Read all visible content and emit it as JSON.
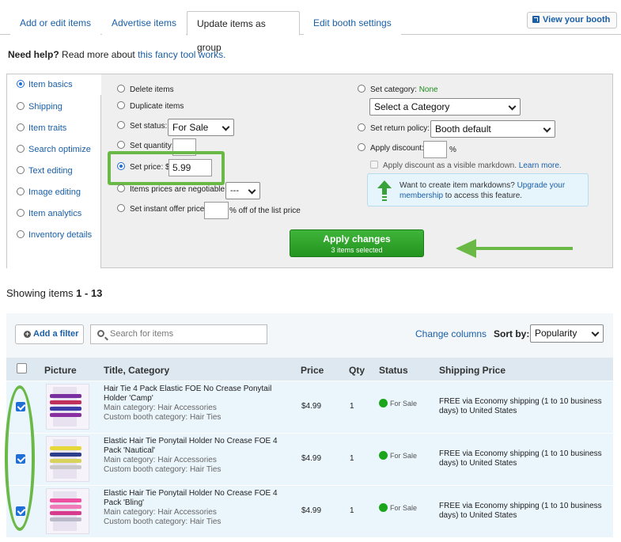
{
  "tabs": [
    "Add or edit items",
    "Advertise items",
    "Update items as group",
    "Edit booth settings"
  ],
  "active_tab": "Update items as group",
  "view_booth": "View your booth",
  "help": {
    "bold": "Need help?",
    "text": " Read more about ",
    "link": "this fancy tool works."
  },
  "sidebar": [
    {
      "label": "Item basics",
      "selected": true
    },
    {
      "label": "Shipping"
    },
    {
      "label": "Item traits"
    },
    {
      "label": "Search optimize"
    },
    {
      "label": "Text editing"
    },
    {
      "label": "Image editing"
    },
    {
      "label": "Item analytics"
    },
    {
      "label": "Inventory details"
    }
  ],
  "options": {
    "delete": "Delete items",
    "duplicate": "Duplicate items",
    "set_status": "Set status:",
    "status_value": "For Sale",
    "set_quantity": "Set quantity:",
    "set_price": "Set price: $",
    "price_value": "5.99",
    "negotiable": "Items prices are negotiable:",
    "negotiable_value": "---",
    "instant_offer": "Set instant offer price:",
    "instant_offer_suffix": "% off of the list price",
    "set_category": "Set category:",
    "category_none": "None",
    "category_select": "Select a Category",
    "return_policy": "Set return policy:",
    "return_value": "Booth default",
    "apply_discount": "Apply discount:",
    "percent": "%",
    "markdown_check": "Apply discount as a visible markdown.",
    "learn_more": "Learn more.",
    "markdown_info": "Want to create item markdowns?",
    "upgrade": "Upgrade your membership",
    "markdown_info_end": " to access this feature."
  },
  "apply": {
    "label": "Apply changes",
    "sub": "3 items selected"
  },
  "showing": {
    "prefix": "Showing items ",
    "range": "1 - 13"
  },
  "toolbar": {
    "add_filter": "Add a filter",
    "search_placeholder": "Search for items",
    "change_columns": "Change columns",
    "sort_label": "Sort by:",
    "sort_value": "Popularity"
  },
  "columns": [
    "Picture",
    "Title, Category",
    "Price",
    "Qty",
    "Status",
    "Shipping Price"
  ],
  "rows": [
    {
      "title": "Hair Tie 4 Pack Elastic FOE No Crease Ponytail Holder 'Camp'",
      "main": "Main category: Hair Accessories",
      "custom": "Custom booth category: Hair Ties",
      "price": "$4.99",
      "qty": "1",
      "status": "For Sale",
      "ship": "FREE via Economy shipping (1 to 10 business days) to United States",
      "checked": true,
      "colors": [
        "#7a2fa0",
        "#c0305a",
        "#3c3ca8",
        "#8a2fa0"
      ]
    },
    {
      "title": "Elastic Hair Tie Ponytail Holder No Crease FOE 4 Pack 'Nautical'",
      "main": "Main category: Hair Accessories",
      "custom": "Custom booth category: Hair Ties",
      "price": "$4.99",
      "qty": "1",
      "status": "For Sale",
      "ship": "FREE via Economy shipping (1 to 10 business days) to United States",
      "checked": true,
      "colors": [
        "#e7d83a",
        "#2d3f8a",
        "#d8d35a",
        "#c9c9c9"
      ]
    },
    {
      "title": "Elastic Hair Tie Ponytail Holder No Crease FOE 4 Pack 'Bling'",
      "main": "Main category: Hair Accessories",
      "custom": "Custom booth category: Hair Ties",
      "price": "$4.99",
      "qty": "1",
      "status": "For Sale",
      "ship": "FREE via Economy shipping (1 to 10 business days) to United States",
      "checked": true,
      "colors": [
        "#ee4fa0",
        "#f07ab8",
        "#d83a8c",
        "#b9b9c9"
      ]
    }
  ]
}
